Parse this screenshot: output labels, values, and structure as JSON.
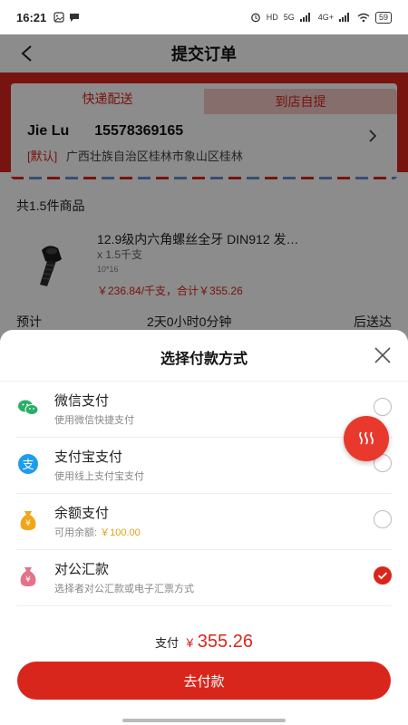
{
  "status_bar": {
    "time": "16:21",
    "network_labels": [
      "HD",
      "5G",
      "4G+"
    ],
    "battery": "59"
  },
  "header": {
    "title": "提交订单"
  },
  "address_card": {
    "tabs": [
      {
        "label": "快递配送",
        "active": true
      },
      {
        "label": "到店自提",
        "active": false
      }
    ],
    "name": "Jie Lu",
    "phone": "15578369165",
    "default_tag": "[默认]",
    "address": "广西壮族自治区桂林市象山区桂林"
  },
  "goods": {
    "count_label": "共1.5件商品",
    "item": {
      "title": "12.9级内六角螺丝全牙 DIN912 发…",
      "quantity": "x 1.5千支",
      "spec": "10*16",
      "price": "￥236.84/千支，合计￥355.26"
    }
  },
  "eta": {
    "label": "预计",
    "duration": "2天0小时0分钟",
    "suffix": "后送达"
  },
  "payment_sheet": {
    "title": "选择付款方式",
    "options": [
      {
        "name": "微信支付",
        "desc": "使用微信快捷支付",
        "icon": "wechat-pay-icon",
        "selected": false
      },
      {
        "name": "支付宝支付",
        "desc": "使用线上支付宝支付",
        "icon": "alipay-icon",
        "selected": false
      },
      {
        "name": "余额支付",
        "desc_prefix": "可用余额: ",
        "desc_amount": "￥100.00",
        "icon": "balance-bag-icon",
        "selected": false
      },
      {
        "name": "对公汇款",
        "desc": "选择者对公汇款或电子汇票方式",
        "icon": "transfer-bag-icon",
        "selected": true
      }
    ],
    "total_label": "支付",
    "currency": "¥",
    "total_amount": "355.26",
    "pay_button_label": "去付款"
  },
  "colors": {
    "accent": "#d9261c",
    "balance_amount": "#e0a21b",
    "wechat": "#2aae67",
    "alipay": "#1c9ded"
  }
}
